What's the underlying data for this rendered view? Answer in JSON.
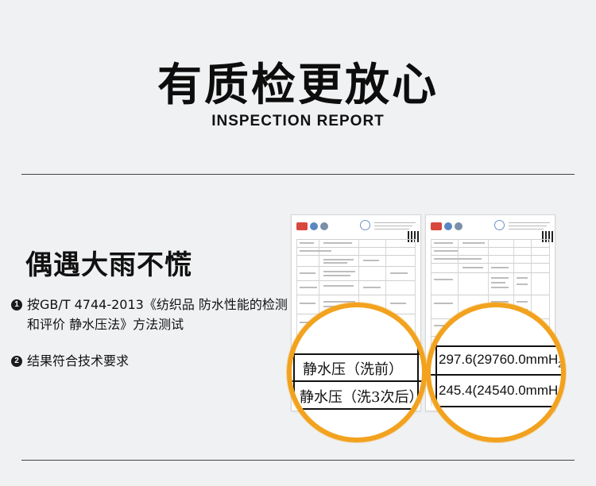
{
  "header": {
    "title_cn": "有质检更放心",
    "title_en": "INSPECTION REPORT"
  },
  "section": {
    "heading": "偶遇大雨不慌",
    "points": [
      {
        "index": "1",
        "text": "按GB/T 4744-2013《纺织品 防水性能的检测和评价 静水压法》方法测试"
      },
      {
        "index": "2",
        "text": "结果符合技术要求"
      }
    ]
  },
  "magnifiers": {
    "left": {
      "row1": "静水压（洗前）",
      "row2": "静水压（洗3次后）"
    },
    "right": {
      "row1": "297.6(29760.0mmH",
      "row2": "245.4(24540.0mmH",
      "subscript": "2"
    }
  },
  "colors": {
    "accent": "#f2a21e",
    "background": "#f0f1f3"
  }
}
